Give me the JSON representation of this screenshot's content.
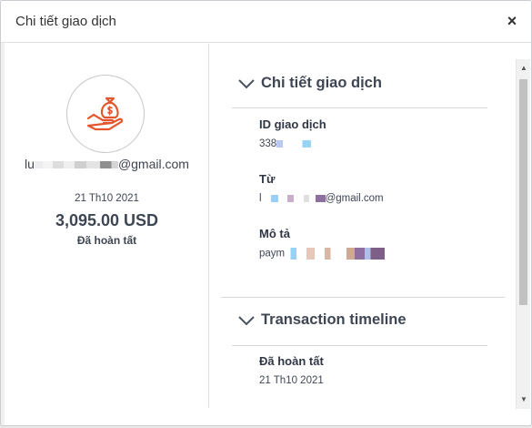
{
  "dialog": {
    "title": "Chi tiết giao dịch",
    "close_label": "×"
  },
  "summary": {
    "icon": "hand-money-bag-icon",
    "email_prefix": "lu",
    "email_suffix": "@gmail.com",
    "date": "21 Th10 2021",
    "amount": "3,095.00 USD",
    "status": "Đã hoàn tất"
  },
  "details": {
    "heading": "Chi tiết giao dịch",
    "fields": [
      {
        "label": "ID giao dịch",
        "value": "338"
      },
      {
        "label": "Từ",
        "value_prefix": "l",
        "value_suffix": "@gmail.com"
      },
      {
        "label": "Mô tả",
        "value": "paym"
      }
    ]
  },
  "timeline": {
    "heading": "Transaction timeline",
    "status": "Đã hoàn tất",
    "date": "21 Th10 2021"
  },
  "colors": {
    "accent_orange": "#e4572e",
    "text": "#3e4654"
  }
}
